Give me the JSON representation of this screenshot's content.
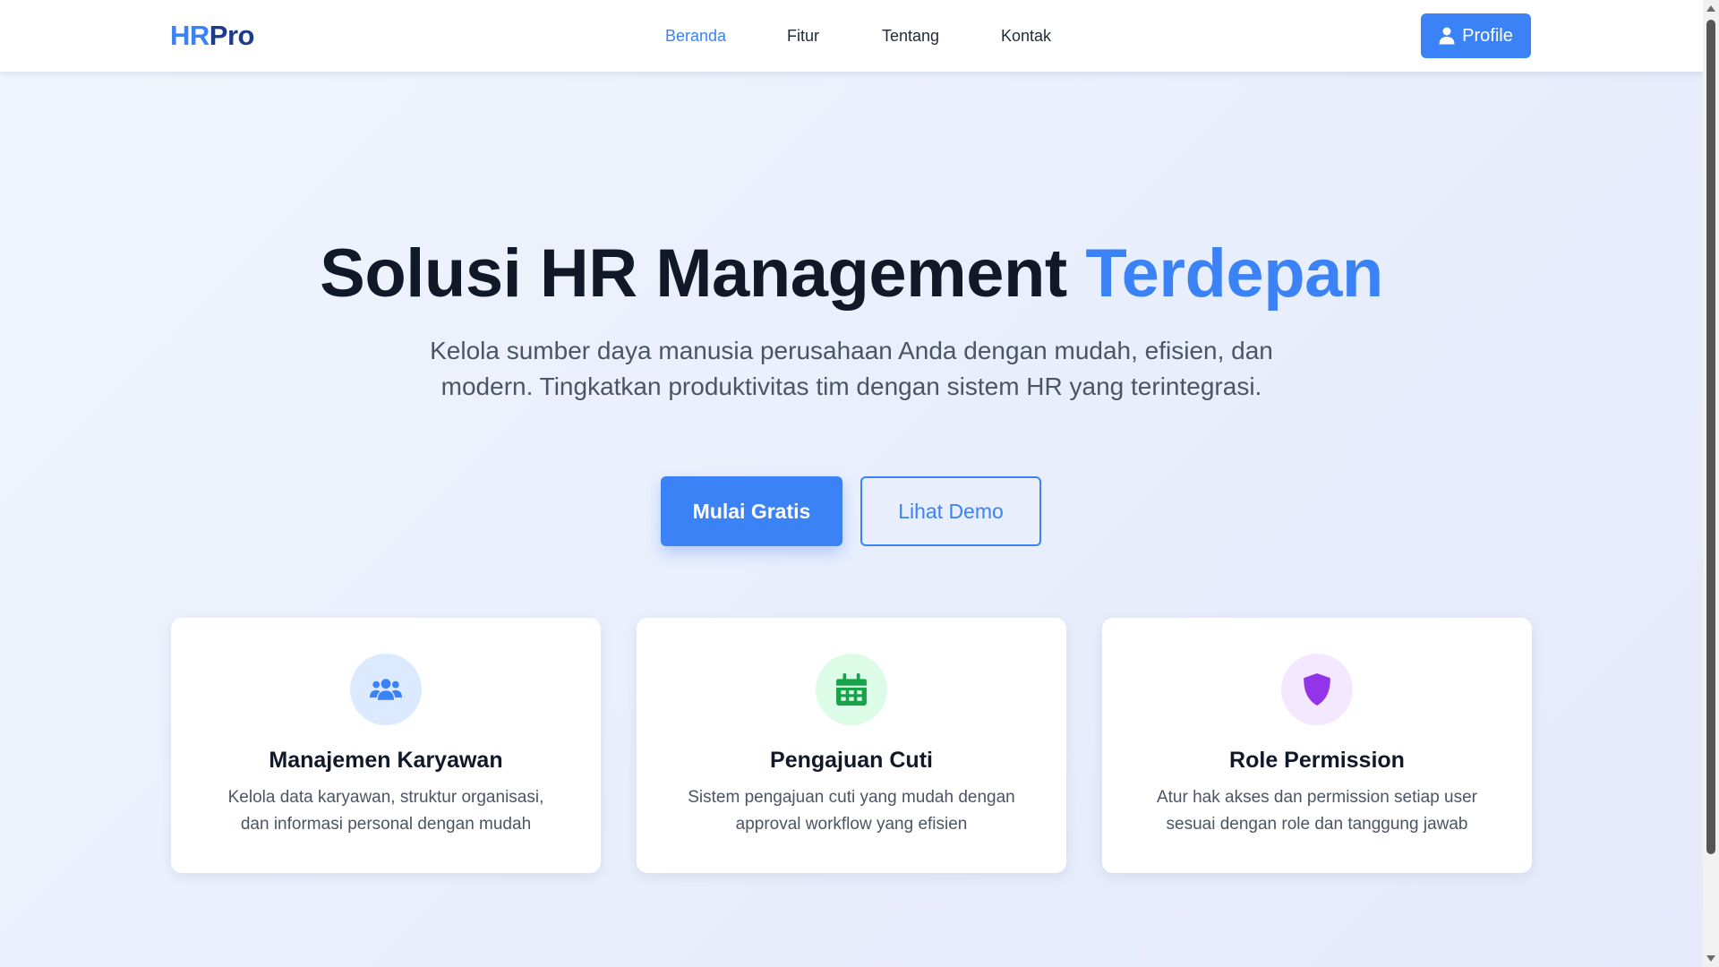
{
  "nav": {
    "logo_part1": "HR",
    "logo_part2": "Pro",
    "links": [
      "Beranda",
      "Fitur",
      "Tentang",
      "Kontak"
    ],
    "active_link": "Beranda",
    "profile_label": "Profile",
    "profile_icon": "user-icon"
  },
  "hero": {
    "title_main": "Solusi HR Management",
    "title_accent": "Terdepan",
    "subtitle": "Kelola sumber daya manusia perusahaan Anda dengan mudah, efisien, dan modern. Tingkatkan produktivitas tim dengan sistem HR yang terintegrasi.",
    "primary_button": "Mulai Gratis",
    "secondary_button": "Lihat Demo"
  },
  "features": [
    {
      "title": "Manajemen Karyawan",
      "description": "Kelola data karyawan, struktur organisasi, dan informasi personal dengan mudah",
      "icon": "users-icon",
      "icon_color": "#3b82f6",
      "icon_bg": "#dbeafe"
    },
    {
      "title": "Pengajuan Cuti",
      "description": "Sistem pengajuan cuti yang mudah dengan approval workflow yang efisien",
      "icon": "calendar-icon",
      "icon_color": "#16a34a",
      "icon_bg": "#dcfce7"
    },
    {
      "title": "Role Permission",
      "description": "Atur hak akses dan permission setiap user sesuai dengan role dan tanggung jawab",
      "icon": "shield-icon",
      "icon_color": "#9333ea",
      "icon_bg": "#f3e8ff"
    }
  ],
  "colors": {
    "accent": "#3b82f6",
    "logo_dark": "#1e3a8a",
    "heading": "#111827",
    "body_text": "#4b5563"
  }
}
